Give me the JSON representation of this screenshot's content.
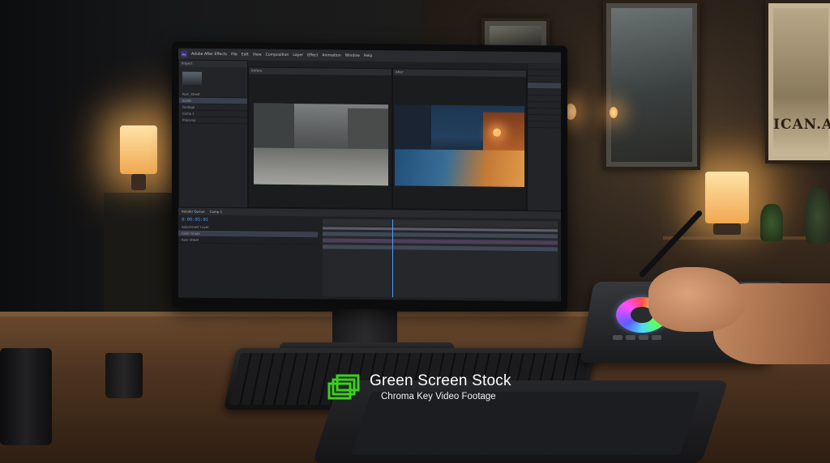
{
  "app": {
    "window_title": "Adobe After Effects",
    "menu": [
      "File",
      "Edit",
      "View",
      "Composition",
      "Layer",
      "Effect",
      "Animation",
      "Window",
      "Help"
    ],
    "project_panel": {
      "header": "Project",
      "rows": [
        "Rain_Street",
        "Solids",
        "Footage",
        "Comp 1",
        "Precomp"
      ]
    },
    "viewer_labels": {
      "left": "Before",
      "right": "After"
    },
    "timeline": {
      "tabs": [
        "Render Queue",
        "Comp 1"
      ],
      "timecode": "0:00:05:01",
      "layers": [
        "Adjustment Layer",
        "Color Grade",
        "Rain Street"
      ]
    }
  },
  "room": {
    "poster_caption": "ICAN.A"
  },
  "watermark": {
    "title": "Green Screen Stock",
    "subtitle": "Chroma Key Video Footage",
    "color": "#3bd11e"
  }
}
